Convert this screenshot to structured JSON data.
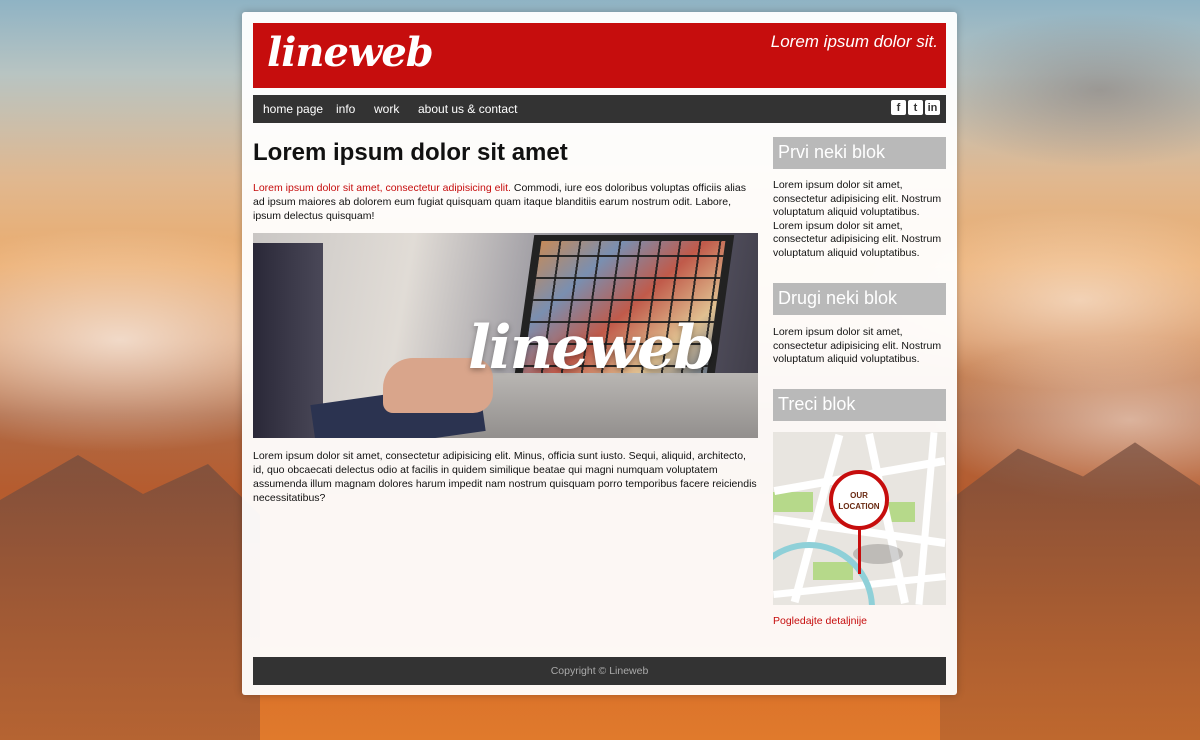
{
  "header": {
    "logo_text": "lineweb",
    "tagline": "Lorem ipsum dolor sit."
  },
  "nav": {
    "items": [
      {
        "label": "home page"
      },
      {
        "label": "info"
      },
      {
        "label": "work"
      },
      {
        "label": "about us & contact"
      }
    ],
    "social": [
      {
        "icon": "facebook-icon",
        "glyph": "f"
      },
      {
        "icon": "twitter-icon",
        "glyph": "t"
      },
      {
        "icon": "linkedin-icon",
        "glyph": "in"
      }
    ]
  },
  "main": {
    "title": "Lorem ipsum dolor sit amet",
    "intro_highlight": "Lorem ipsum dolor sit amet, consectetur adipisicing elit.",
    "intro_rest": " Commodi, iure eos doloribus voluptas officiis alias ad ipsum maiores ab dolorem eum fugiat quisquam quam itaque blanditiis earum nostrum odit. Labore, ipsum delectus quisquam!",
    "hero_logo": "lineweb",
    "body": "Lorem ipsum dolor sit amet, consectetur adipisicing elit. Minus, officia sunt iusto. Sequi, aliquid, architecto, id, quo obcaecati delectus odio at facilis in quidem similique beatae qui magni numquam voluptatem assumenda illum magnam dolores harum impedit nam nostrum quisquam porro temporibus facere reiciendis necessitatibus?"
  },
  "sidebar": {
    "block1": {
      "title": "Prvi neki blok",
      "text": "Lorem ipsum dolor sit amet, consectetur adipisicing elit. Nostrum voluptatum aliquid voluptatibus. Lorem ipsum dolor sit amet, consectetur adipisicing elit. Nostrum voluptatum aliquid voluptatibus."
    },
    "block2": {
      "title": "Drugi neki blok",
      "text": "Lorem ipsum dolor sit amet, consectetur adipisicing elit. Nostrum voluptatum aliquid voluptatibus."
    },
    "block3": {
      "title": "Treci blok",
      "map_pin_line1": "OUR",
      "map_pin_line2": "LOCATION",
      "link": "Pogledajte detaljnije"
    }
  },
  "footer": {
    "copyright": "Copyright © Lineweb"
  },
  "colors": {
    "brand_red": "#c60d0d",
    "nav_dark": "#333333",
    "sidebar_gray": "#b9b9b9"
  }
}
